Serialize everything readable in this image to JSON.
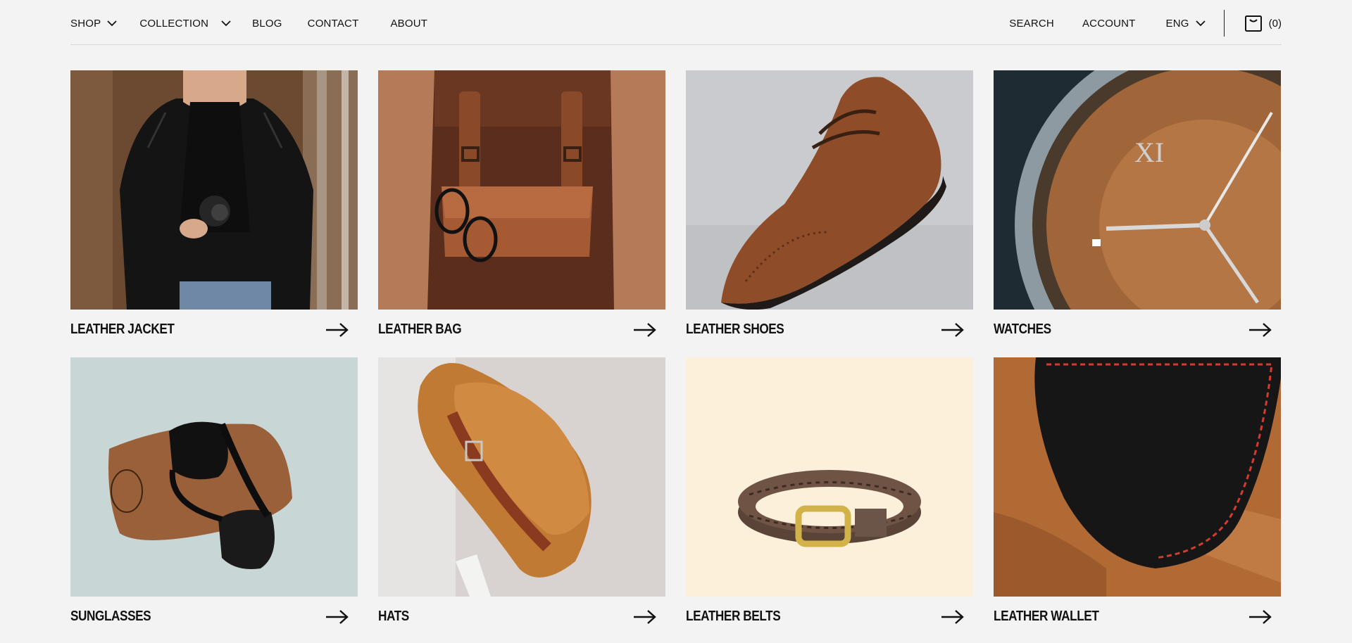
{
  "nav": {
    "left": [
      {
        "label": "SHOP",
        "has_dropdown": true
      },
      {
        "label": "COLLECTION",
        "has_dropdown": true
      },
      {
        "label": "BLOG",
        "has_dropdown": false
      },
      {
        "label": "CONTACT",
        "has_dropdown": false
      },
      {
        "label": "ABOUT",
        "has_dropdown": false
      }
    ],
    "search_label": "SEARCH",
    "account_label": "ACCOUNT",
    "language_label": "ENG",
    "cart_count": "(0)"
  },
  "categories": [
    {
      "label": "LEATHER JACKET",
      "image": "man-in-leather-jacket-with-camera",
      "bg": "#5a3d28"
    },
    {
      "label": "LEATHER BAG",
      "image": "brown-leather-backpack-with-glasses",
      "bg": "#b57a57"
    },
    {
      "label": "LEATHER SHOES",
      "image": "brown-brogue-oxford-shoe",
      "bg": "#c9cbce"
    },
    {
      "label": "WATCHES",
      "image": "bronze-watch-dial-closeup",
      "bg": "#1f2b33"
    },
    {
      "label": "SUNGLASSES",
      "image": "black-sunglasses-on-brown-case",
      "bg": "#c8d6d6"
    },
    {
      "label": "HATS",
      "image": "orange-fedora-hat",
      "bg": "#d8d3d0"
    },
    {
      "label": "LEATHER BELTS",
      "image": "braided-leather-belt-gold-buckle",
      "bg": "#fdf0db"
    },
    {
      "label": "LEATHER WALLET",
      "image": "black-leather-wallet-red-stitching",
      "bg": "#b26a35"
    }
  ]
}
